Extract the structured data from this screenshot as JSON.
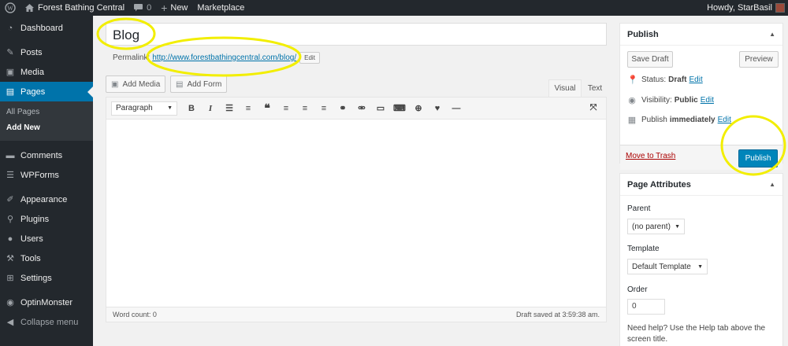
{
  "adminbar": {
    "site_name": "Forest Bathing Central",
    "comments_count": "0",
    "new_label": "New",
    "marketplace_label": "Marketplace",
    "greeting": "Howdy, StarBasil"
  },
  "sidebar": {
    "items": [
      {
        "label": "Dashboard",
        "icon": "dashboard-icon"
      },
      {
        "label": "Posts",
        "icon": "pin-icon"
      },
      {
        "label": "Media",
        "icon": "media-icon"
      },
      {
        "label": "Pages",
        "icon": "pages-icon"
      },
      {
        "label": "Comments",
        "icon": "comments-icon"
      },
      {
        "label": "WPForms",
        "icon": "forms-icon"
      },
      {
        "label": "Appearance",
        "icon": "brush-icon"
      },
      {
        "label": "Plugins",
        "icon": "plugin-icon"
      },
      {
        "label": "Users",
        "icon": "users-icon"
      },
      {
        "label": "Tools",
        "icon": "wrench-icon"
      },
      {
        "label": "Settings",
        "icon": "settings-icon"
      },
      {
        "label": "OptinMonster",
        "icon": "optinmonster-icon"
      },
      {
        "label": "Collapse menu",
        "icon": "collapse-icon"
      }
    ],
    "submenu": [
      "All Pages",
      "Add New"
    ]
  },
  "editor": {
    "title": "Blog",
    "permalink_label": "Permalink:",
    "permalink_url": "http://www.forestbathingcentral.com/blog/",
    "permalink_edit": "Edit",
    "add_media": "Add Media",
    "add_form": "Add Form",
    "tab_visual": "Visual",
    "tab_text": "Text",
    "format_select": "Paragraph",
    "word_count": "Word count: 0",
    "draft_saved": "Draft saved at 3:59:38 am."
  },
  "publish_box": {
    "heading": "Publish",
    "save_draft": "Save Draft",
    "preview": "Preview",
    "status_label": "Status:",
    "status_value": "Draft",
    "visibility_label": "Visibility:",
    "visibility_value": "Public",
    "publish_label": "Publish",
    "publish_value": "immediately",
    "edit_link": "Edit",
    "move_to_trash": "Move to Trash",
    "publish_button": "Publish"
  },
  "page_attributes": {
    "heading": "Page Attributes",
    "parent_label": "Parent",
    "parent_value": "(no parent)",
    "template_label": "Template",
    "template_value": "Default Template",
    "order_label": "Order",
    "order_value": "0",
    "help_text": "Need help? Use the Help tab above the screen title."
  },
  "colors": {
    "admin_dark": "#23282d",
    "accent_blue": "#0073aa",
    "publish_blue": "#0085ba",
    "highlight_yellow": "#f2ee00"
  }
}
